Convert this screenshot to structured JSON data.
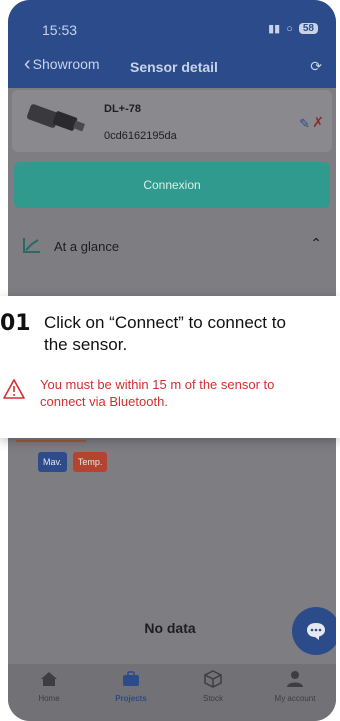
{
  "status_bar": {
    "time": "15:53",
    "signal": "▐▐",
    "battery": "58"
  },
  "header": {
    "back_label": "Showroom",
    "title": "Sensor detail"
  },
  "sensor": {
    "name": "DL+-78",
    "id": "0cd6162195da"
  },
  "connect_button": {
    "label": "Connexion"
  },
  "glance": {
    "label": "At a glance"
  },
  "tooltip": {
    "step_number": "01",
    "step_text": "Click on “Connect” to connect to\nthe sensor.",
    "warning_text": "You must be within 15 m of the sensor to\nconnect via Bluetooth."
  },
  "tags": [
    "Mav.",
    "Temp."
  ],
  "empty_state": {
    "label": "No data"
  },
  "bottom_nav": [
    {
      "label": "Home",
      "icon": "home-icon",
      "active": false
    },
    {
      "label": "Projects",
      "icon": "briefcase-icon",
      "active": true
    },
    {
      "label": "Stock",
      "icon": "box-icon",
      "active": false
    },
    {
      "label": "My account",
      "icon": "user-icon",
      "active": false
    }
  ],
  "colors": {
    "header": "#2b4b8a",
    "connect": "#319a8e",
    "warning": "#d03030",
    "tag_mav": "#2f4c8a",
    "tag_temp": "#b4442f"
  }
}
